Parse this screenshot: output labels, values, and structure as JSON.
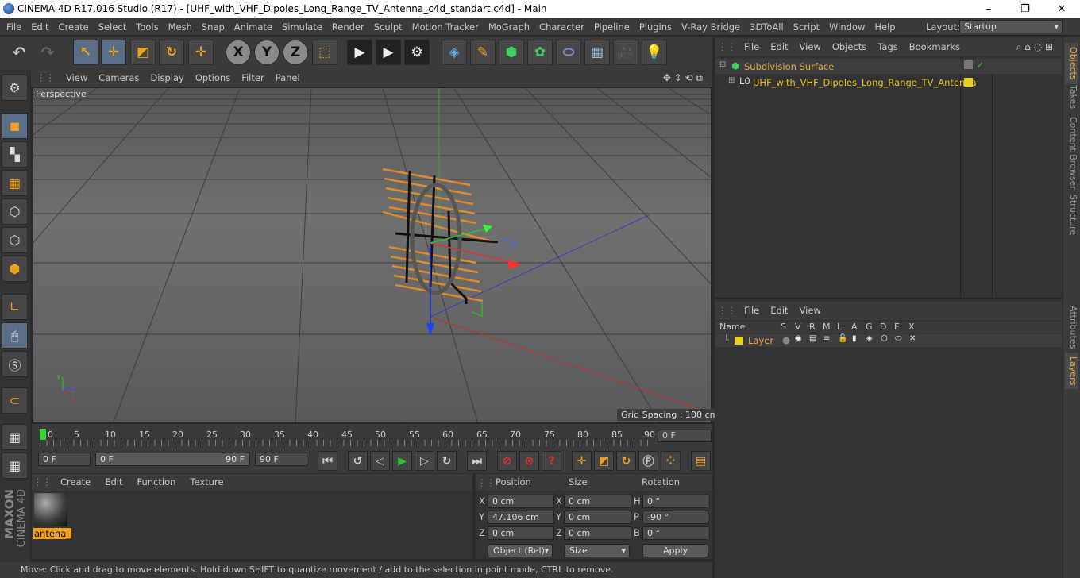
{
  "window": {
    "title": "CINEMA 4D R17.016 Studio (R17) - [UHF_with_VHF_Dipoles_Long_Range_TV_Antenna_c4d_standart.c4d] - Main",
    "minimize": "–",
    "maximize": "❐",
    "close": "✕"
  },
  "menu": [
    "File",
    "Edit",
    "Create",
    "Select",
    "Tools",
    "Mesh",
    "Snap",
    "Animate",
    "Simulate",
    "Render",
    "Sculpt",
    "Motion Tracker",
    "MoGraph",
    "Character",
    "Pipeline",
    "Plugins",
    "V-Ray Bridge",
    "3DToAll",
    "Script",
    "Window",
    "Help"
  ],
  "layout": {
    "label": "Layout:",
    "value": "Startup"
  },
  "toolbar": {
    "undo_icon": "undo-icon",
    "redo_icon": "redo-icon",
    "x": "X",
    "y": "Y",
    "z": "Z"
  },
  "viewport": {
    "menu": [
      "View",
      "Cameras",
      "Display",
      "Options",
      "Filter",
      "Panel"
    ],
    "label": "Perspective",
    "grid_spacing": "Grid Spacing : 100 cm",
    "axis_y": "Y",
    "axis_z": "Z",
    "axis_x": "X"
  },
  "timeline": {
    "ticks": [
      "0",
      "5",
      "10",
      "15",
      "20",
      "25",
      "30",
      "35",
      "40",
      "45",
      "50",
      "55",
      "60",
      "65",
      "70",
      "75",
      "80",
      "85",
      "90"
    ],
    "current": "0 F"
  },
  "playback": {
    "start": "0 F",
    "range_start": "0 F",
    "range_end": "90 F",
    "end": "90 F"
  },
  "material_panel": {
    "menu": [
      "Create",
      "Edit",
      "Function",
      "Texture"
    ],
    "material_name": "antena_"
  },
  "coords": {
    "headers": [
      "Position",
      "Size",
      "Rotation"
    ],
    "rows": [
      {
        "axis": "X",
        "pos": "0 cm",
        "saxis": "X",
        "size": "0 cm",
        "raxis": "H",
        "rot": "0 °"
      },
      {
        "axis": "Y",
        "pos": "47.106 cm",
        "saxis": "Y",
        "size": "0 cm",
        "raxis": "P",
        "rot": "-90 °"
      },
      {
        "axis": "Z",
        "pos": "0 cm",
        "saxis": "Z",
        "size": "0 cm",
        "raxis": "B",
        "rot": "0 °"
      }
    ],
    "mode": "Object (Rel)",
    "size_mode": "Size",
    "apply": "Apply"
  },
  "status": "Move: Click and drag to move elements. Hold down SHIFT to quantize movement / add to the selection in point mode, CTRL to remove.",
  "objects_panel": {
    "menu": [
      "File",
      "Edit",
      "View",
      "Objects",
      "Tags",
      "Bookmarks"
    ],
    "items": [
      {
        "name": "Subdivision Surface"
      },
      {
        "name": "UHF_with_VHF_Dipoles_Long_Range_TV_Antenna"
      }
    ]
  },
  "layers_panel": {
    "menu": [
      "File",
      "Edit",
      "View"
    ],
    "columns": [
      "Name",
      "S",
      "V",
      "R",
      "M",
      "L",
      "A",
      "G",
      "D",
      "E",
      "X"
    ],
    "layer_name": "Layer"
  },
  "side_tabs": [
    "Objects",
    "Takes",
    "Content Browser",
    "Structure",
    "Attributes",
    "Layers"
  ],
  "brand": {
    "line1": "MAXON",
    "line2": "CINEMA 4D"
  },
  "colors": {
    "accent": "#e8a84a",
    "selected_tool": "#5a6f87",
    "axis_x": "#e03030",
    "axis_y": "#30c030",
    "axis_z": "#3050e0"
  }
}
